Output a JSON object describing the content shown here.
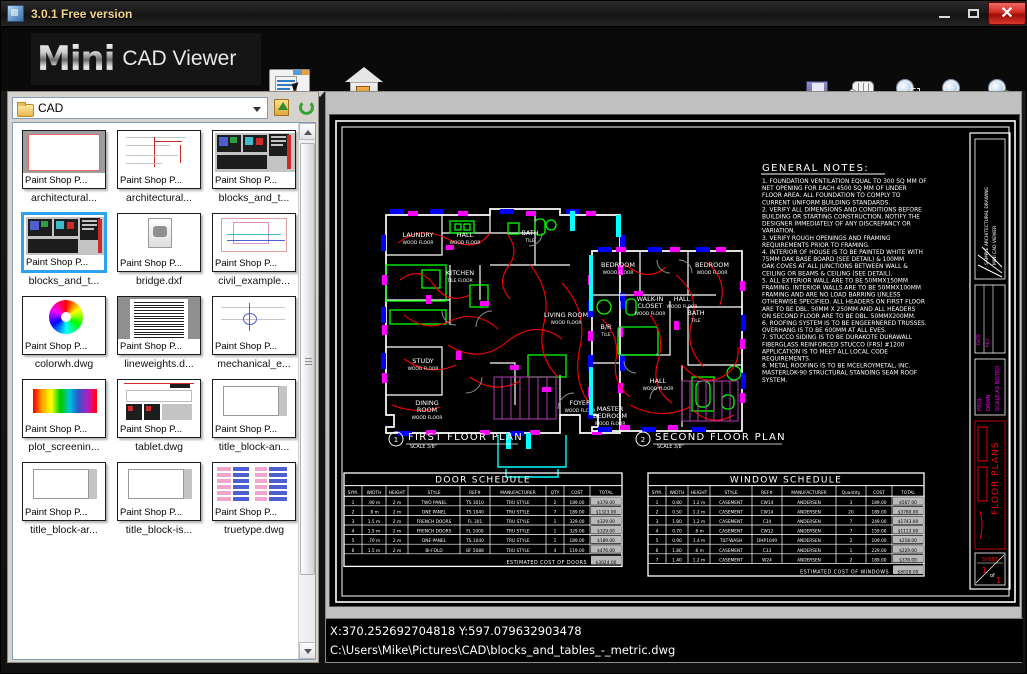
{
  "window": {
    "title": "3.0.1 Free version",
    "icon": "app-icon",
    "buttons": {
      "minimize": "–",
      "maximize": "☐",
      "close": "✕"
    }
  },
  "branding": {
    "name_bold": "Mini",
    "name_rest": "CAD Viewer"
  },
  "toolbar": {
    "layout_button": "layout-view-button",
    "home_button": "home-button",
    "right_tools": [
      {
        "name": "save-icon",
        "label": "Save"
      },
      {
        "name": "pan-hand-icon",
        "label": "Pan"
      },
      {
        "name": "zoom-window-icon",
        "label": "Zoom Window"
      },
      {
        "name": "zoom-in-out-icon",
        "label": "Zoom In/Out"
      },
      {
        "name": "zoom-extents-icon",
        "label": "Zoom Extents"
      }
    ]
  },
  "browser": {
    "path_value": "CAD",
    "path_placeholder": "CAD",
    "up_folder_label": "Up one level",
    "refresh_label": "Refresh",
    "thumb_caption": "Paint Shop P...",
    "files": [
      {
        "name": "architectural...",
        "art": "arch1",
        "selected": false
      },
      {
        "name": "architectural...",
        "art": "arch2",
        "selected": false
      },
      {
        "name": "blocks_and_t...",
        "art": "blocks",
        "selected": false
      },
      {
        "name": "blocks_and_t...",
        "art": "blocks",
        "selected": true
      },
      {
        "name": "bridge.dxf",
        "art": "dxf",
        "selected": false
      },
      {
        "name": "civil_example...",
        "art": "civil",
        "selected": false
      },
      {
        "name": "colorwh.dwg",
        "art": "colorwheel",
        "selected": false
      },
      {
        "name": "lineweights.d...",
        "art": "lineweights",
        "selected": false
      },
      {
        "name": "mechanical_e...",
        "art": "mech",
        "selected": false
      },
      {
        "name": "plot_screenin...",
        "art": "plot",
        "selected": false
      },
      {
        "name": "tablet.dwg",
        "art": "tablet",
        "selected": false
      },
      {
        "name": "title_block-an...",
        "art": "titleblock",
        "selected": false
      },
      {
        "name": "title_block-ar...",
        "art": "titleblock",
        "selected": false
      },
      {
        "name": "title_block-is...",
        "art": "titleblock",
        "selected": false
      },
      {
        "name": "truetype.dwg",
        "art": "truetype",
        "selected": false
      }
    ]
  },
  "status": {
    "coordinates": "X:370.252692704818  Y:597.079632903478",
    "file_path": "C:\\Users\\Mike\\Pictures\\CAD\\blocks_and_tables_-_metric.dwg"
  },
  "drawing": {
    "notes_title": "GENERAL NOTES:",
    "notes": [
      "1. FOUNDATION VENTILATION EQUAL TO 300 SQ MM OF",
      "   NET OPENING FOR EACH 4500 SQ MM OF UNDER",
      "   FLOOR AREA. ALL FOUNDATION TO COMPLY TO",
      "   CURRENT UNIFORM BUILDING STANDARDS.",
      "2. VERIFY ALL DIMENSIONS AND CONDITIONS BEFORE",
      "   BUILDING OR STARTING CONSTRUCTION. NOTIFY THE",
      "   DESIGNER IMMEDIATELY OF ANY DISCREPANCY OR",
      "   VARIATION.",
      "3. VERIFY ROUGH OPENINGS AND FRAMING",
      "   REQUIREMENTS PRIOR TO FRAMING.",
      "4. INTERIOR OF HOUSE IS TO BE PAINTED WHITE WITH",
      "   75MM OAK  BASE BOARD (SEE DETAIL) & 100MM",
      "   OAK COVES AT ALL JUNCTIONS BETWEEN WALL &",
      "   CEILING OR BEAMS & CEILING (SEE DETAIL).",
      "5. ALL EXTERIOR WALL ARE TO BE 50MMX150MM",
      "   FRAMING. INTERIOR WALLS ARE TO BE 50MMX100MM",
      "   FRAMING AND ARE NO LOAD BARRING UNLESS",
      "   OTHERWISE SPECIFIED. ALL HEADERS ON FIRST FLOOR",
      "   ARE TO BE DBL. 50MM X 250MM AND ALL HEADERS",
      "   ON SECOND FLOOR ARE TO BE DBL. 50MMX200MM.",
      "6. ROOFING SYSTEM IS TO BE ENGEERNERED TRUSSES.",
      "   OVERHANG IS TO BE 600MM AT ALL EVES.",
      "7. STUCCO SIDING IS TO BE DURAKOTE DURAWALL",
      "   FIBERGLASS REINFORCED STUCCO (FRS) #1200",
      "   APPLICATION IS TO MEET ALL LOCAL CODE",
      "   REQUIREMENTS.",
      "8. METAL ROOFING IS TO BE MCELROYMETAL, INC.",
      "   MASTERLOK-90 STRUCTURAL STANDING SEAM ROOF",
      "   SYSTEM."
    ],
    "plan1_label": "FIRST FLOOR PLAN",
    "plan1_scale": "SCALE  3/8\"",
    "plan1_marker": "1",
    "plan2_label": "SECOND FLOOR PLAN",
    "plan2_scale": "SCALE  3/8\"",
    "plan2_marker": "2",
    "rooms_floor1": [
      "LAUNDRY",
      "HALL",
      "BATH",
      "KITCHEN",
      "LIVING ROOM",
      "STUDY",
      "DINING ROOM",
      "FOYER"
    ],
    "rooms_floor2": [
      "BEDROOM",
      "BEDROOM",
      "WALK-IN CLOSET",
      "MASTER BEDROOM",
      "BATH",
      "HALL"
    ],
    "titleblock": {
      "sheet_title": "FLOOR PLANS",
      "sheet_label": "SHEET",
      "sheet_num": "1",
      "sheet_of": "of",
      "sheet_total": "1"
    },
    "door_schedule": {
      "title": "DOOR SCHEDULE",
      "columns": [
        "SYM.",
        "WIDTH",
        "HEIGHT",
        "STYLE",
        "REF#",
        "MANUFACTURER",
        "QTY",
        "COST",
        "TOTAL"
      ],
      "rows": [
        [
          "1",
          ".90 m",
          "2 m",
          "TWO PANEL",
          "TS 3010",
          "TRU STYLE",
          "2",
          "189.00",
          "$378.00"
        ],
        [
          "2",
          ".8 m",
          "2 m",
          "ONE PANEL",
          "TS 1040",
          "TRU STYLE",
          "7",
          "189.00",
          "$1323.00"
        ],
        [
          "3",
          "1.5 m",
          "2 m",
          "FRENCH DOORS",
          "FL 301",
          "TRU STYLE",
          "1",
          "329.00",
          "$329.00"
        ],
        [
          "4",
          "1.5 m",
          "2 m",
          "FRENCH DOORS",
          "FL 1000",
          "TRU STYLE",
          "1",
          "329.00",
          "$329.00"
        ],
        [
          "5",
          ".70 m",
          "2 m",
          "ONE PANEL",
          "TS 1040",
          "TRU STYLE",
          "1",
          "189.00",
          "$189.00"
        ],
        [
          "6",
          "1.5 m",
          "2 m",
          "BI-FOLD",
          "BF 5088",
          "TRU STYLE",
          "4",
          "119.00",
          "$476.00"
        ]
      ],
      "footer_label": "ESTIMATED COST OF DOORS",
      "footer_value": "$3024.00"
    },
    "window_schedule": {
      "title": "WINDOW SCHEDULE",
      "columns": [
        "SYM.",
        "WIDTH",
        "HEIGHT",
        "STYLE",
        "REF#",
        "MANUFACTURER",
        "Quantity",
        "COST",
        "TOTAL"
      ],
      "rows": [
        [
          "1",
          "0.80",
          "1.2 m",
          "CASEMENT",
          "CW14",
          "ANDERSEN",
          "3",
          "189.00",
          "$567.00"
        ],
        [
          "2",
          "0.50",
          "1.2 m",
          "CASEMENT",
          "CW14",
          "ANDERSEN",
          "20",
          "189.00",
          "$3780.00"
        ],
        [
          "3",
          "1.80",
          "1.2 m",
          "CASEMENT",
          "C34",
          "ANDERSEN",
          "7",
          "249.00",
          "$1743.00"
        ],
        [
          "4",
          "0.70",
          ".6 m",
          "CASEMENT",
          "CW12",
          "ANDERSEN",
          "7",
          "159.00",
          "$1113.00"
        ],
        [
          "5",
          "0.90",
          "1.4 m",
          "TILT-WASH",
          "DHP1049",
          "ANDERSEN",
          "2",
          "109.00",
          "$218.00"
        ],
        [
          "6",
          "1.80",
          ".6 m",
          "CASEMENT",
          "C33",
          "ANDERSEN",
          "1",
          "229.00",
          "$229.00"
        ],
        [
          "7",
          "1.40",
          "1.2 m",
          "CASEMENT",
          "W24",
          "ANDERSEN",
          "2",
          "189.00",
          "$378.00"
        ]
      ],
      "footer_label": "ESTIMATED COST OF WINDOWS",
      "footer_value": "$8028.00"
    }
  },
  "colors": {
    "cad_background": "#000000",
    "cad_white": "#ffffff",
    "cad_cyan": "#00ffff",
    "cad_red": "#ff0000",
    "cad_blue": "#0000ff",
    "cad_green": "#00ff00",
    "cad_magenta": "#ff00ff",
    "selection": "#2aa3f0",
    "title_text": "#f3d48a"
  }
}
